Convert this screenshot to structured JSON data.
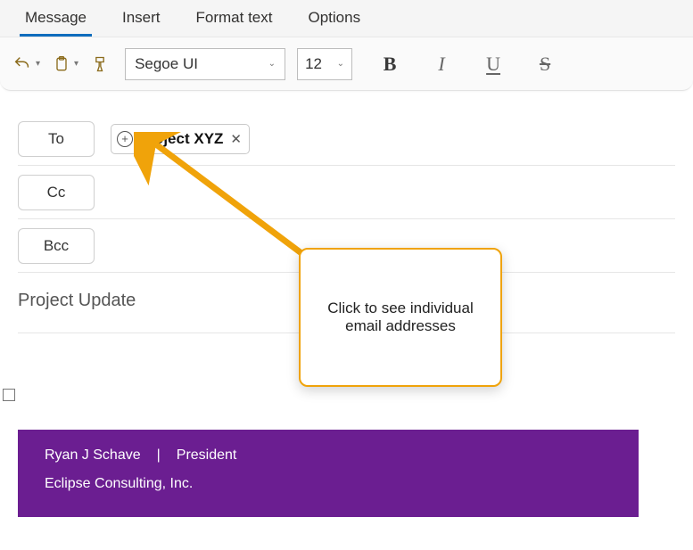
{
  "tabs": {
    "message": "Message",
    "insert": "Insert",
    "format": "Format text",
    "options": "Options"
  },
  "toolbar": {
    "fontName": "Segoe UI",
    "fontSize": "12"
  },
  "compose": {
    "toLabel": "To",
    "ccLabel": "Cc",
    "bccLabel": "Bcc",
    "recipientChip": "Project XYZ",
    "subject": "Project Update"
  },
  "callout": {
    "text": "Click to see individual email addresses"
  },
  "signature": {
    "name": "Ryan J Schave",
    "sep": "|",
    "title": "President",
    "company": "Eclipse Consulting, Inc."
  }
}
